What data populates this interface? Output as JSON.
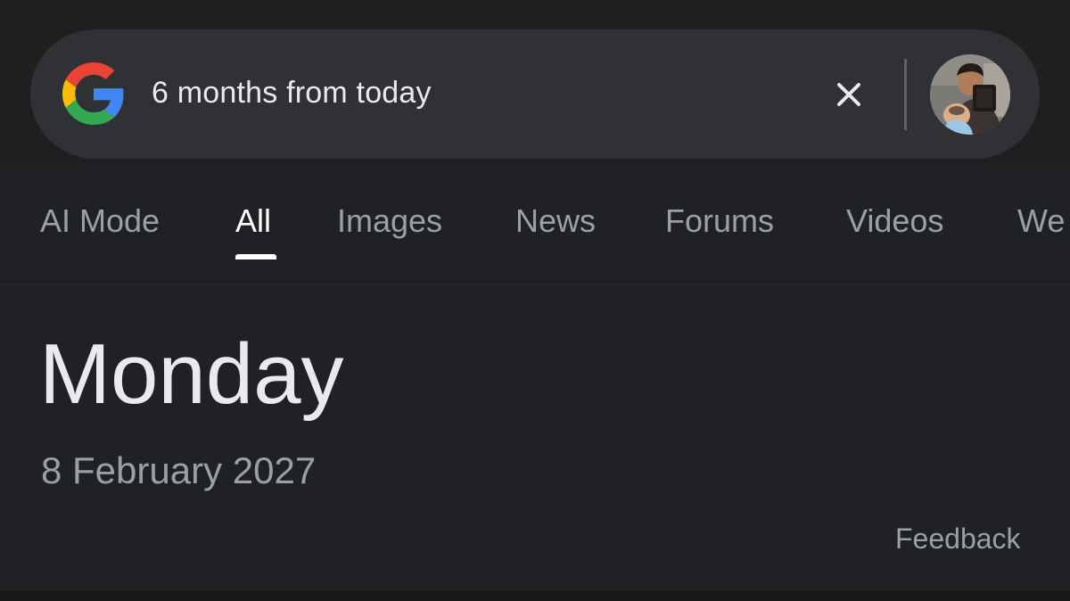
{
  "search": {
    "query": "6 months from today",
    "logo_icon": "google-g-icon",
    "clear_icon": "close-icon"
  },
  "tabs": [
    {
      "label": "AI Mode",
      "active": false
    },
    {
      "label": "All",
      "active": true
    },
    {
      "label": "Images",
      "active": false
    },
    {
      "label": "News",
      "active": false
    },
    {
      "label": "Forums",
      "active": false
    },
    {
      "label": "Videos",
      "active": false
    },
    {
      "label": "We",
      "active": false
    }
  ],
  "result": {
    "day": "Monday",
    "date": "8 February 2027",
    "feedback": "Feedback"
  },
  "colors": {
    "background": "#202124",
    "search_bar": "#303134",
    "text_primary": "#e8eaed",
    "text_secondary": "#9aa0a6",
    "active_tab": "#ffffff"
  }
}
